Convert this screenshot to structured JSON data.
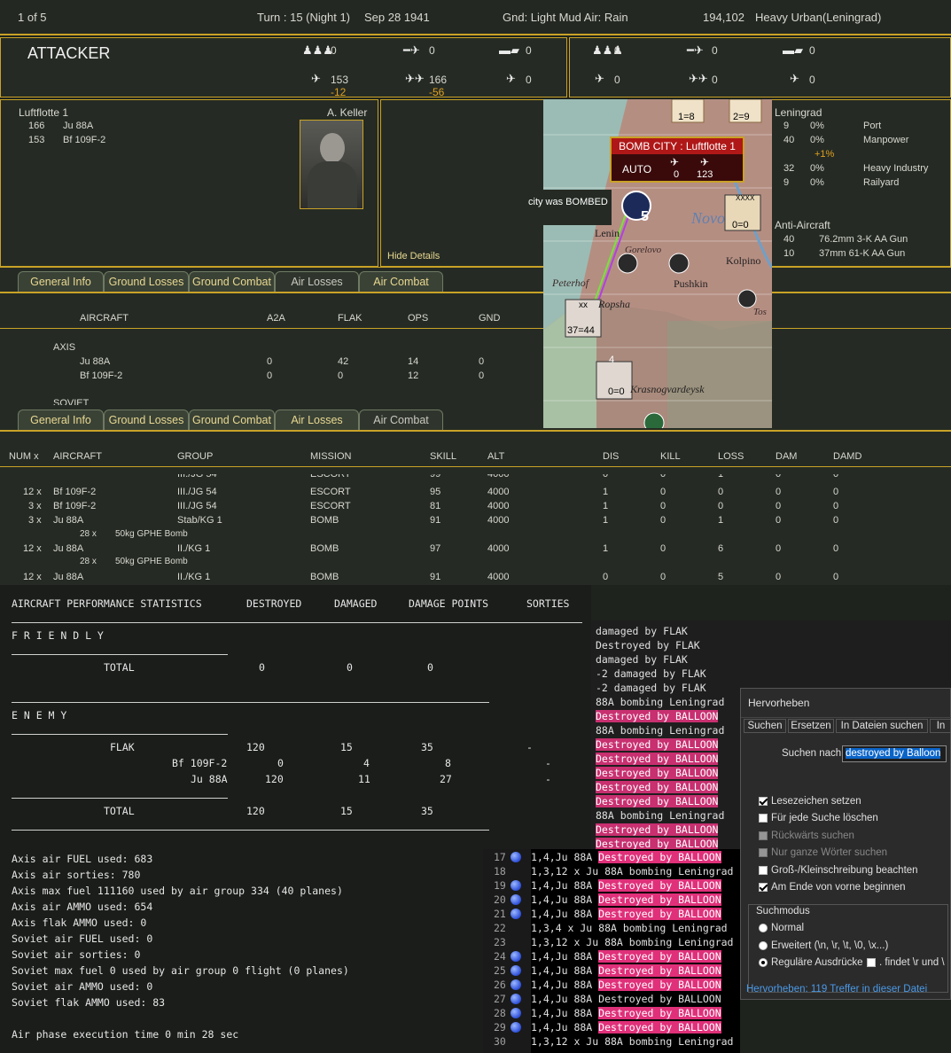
{
  "header": {
    "page_of": "1 of 5",
    "turn": "Turn : 15 (Night 1)",
    "date": "Sep 28 1941",
    "weather": "Gnd: Light Mud  Air: Rain",
    "population": "194,102",
    "terrain": "Heavy Urban(Leningrad)"
  },
  "attacker": {
    "title": "ATTACKER",
    "inf": "0",
    "art": "0",
    "tank": "0",
    "fighter": "153",
    "fighter_loss": "-12",
    "bomber": "166",
    "bomber_loss": "-56",
    "other": "0"
  },
  "defender": {
    "inf": "0",
    "art": "0",
    "tank": "0",
    "fighter": "0",
    "bomber": "0",
    "other": "0"
  },
  "unit": {
    "name": "Luftflotte 1",
    "commander": "A. Keller",
    "rows": [
      {
        "count": "166",
        "type": "Ju 88A"
      },
      {
        "count": "153",
        "type": "Bf 109F-2"
      }
    ],
    "hide_details": "Hide Details"
  },
  "map": {
    "popup_title": "BOMB CITY : Luftflotte 1",
    "popup_auto": "AUTO",
    "popup_fighters": "0",
    "popup_bombers": "123",
    "bombed_label": "city was BOMBED",
    "places": [
      "Peterhof",
      "Pushkin",
      "Kolpino",
      "Ropsha",
      "Krasnogvardeysk",
      "Lenin",
      "Novo",
      "Gorelovo",
      "Tos"
    ],
    "counter_a": "1=8",
    "counter_b": "2=9",
    "counter_c": "0=0",
    "counter_d": "37=44",
    "counter_e": "0=0",
    "counter_xx": "xx",
    "counter_xxxx": "XXXX",
    "num4": "4",
    "num5": "5"
  },
  "city": {
    "name": "Leningrad",
    "rows": [
      {
        "v": "9",
        "pct": "0%",
        "label": "Port"
      },
      {
        "v": "40",
        "pct": "0%",
        "label": "Manpower"
      },
      {
        "v": "",
        "pct": "+1%",
        "label": ""
      },
      {
        "v": "32",
        "pct": "0%",
        "label": "Heavy Industry"
      },
      {
        "v": "9",
        "pct": "0%",
        "label": "Railyard"
      }
    ],
    "aa_title": "Anti-Aircraft",
    "aa": [
      {
        "v": "40",
        "label": "76.2mm 3-K AA Gun"
      },
      {
        "v": "10",
        "label": "37mm 61-K AA Gun"
      }
    ]
  },
  "tabs": [
    "General Info",
    "Ground Losses",
    "Ground Combat",
    "Air Losses",
    "Air Combat"
  ],
  "loss_table": {
    "headers": [
      "AIRCRAFT",
      "A2A",
      "FLAK",
      "OPS",
      "GND"
    ],
    "axis_label": "AXIS",
    "rows": [
      [
        "Ju 88A",
        "0",
        "42",
        "14",
        "0"
      ],
      [
        "Bf 109F-2",
        "0",
        "0",
        "12",
        "0"
      ]
    ],
    "soviet_label": "SOVIET"
  },
  "combat_table": {
    "headers": [
      "NUM x",
      "AIRCRAFT",
      "GROUP",
      "MISSION",
      "SKILL",
      "ALT",
      "DIS",
      "KILL",
      "LOSS",
      "DAM",
      "DAMD"
    ],
    "partial_row": [
      "",
      "",
      "III./JG 54",
      "ESCORT",
      "99",
      "4000",
      "0",
      "0",
      "1",
      "0",
      "0"
    ],
    "rows": [
      [
        "12 x",
        "Bf 109F-2",
        "III./JG 54",
        "ESCORT",
        "95",
        "4000",
        "1",
        "0",
        "0",
        "0",
        "0"
      ],
      [
        "3 x",
        "Bf 109F-2",
        "III./JG 54",
        "ESCORT",
        "81",
        "4000",
        "1",
        "0",
        "0",
        "0",
        "0"
      ],
      [
        "3 x",
        "Ju 88A",
        "Stab/KG 1",
        "BOMB",
        "91",
        "4000",
        "1",
        "0",
        "1",
        "0",
        "0"
      ],
      [
        "12 x",
        "Ju 88A",
        "II./KG 1",
        "BOMB",
        "97",
        "4000",
        "1",
        "0",
        "6",
        "0",
        "0"
      ],
      [
        "12 x",
        "Ju 88A",
        "II./KG 1",
        "BOMB",
        "91",
        "4000",
        "0",
        "0",
        "5",
        "0",
        "0"
      ]
    ],
    "bomb_count": "28 x",
    "bomb_type": "50kg GPHE Bomb"
  },
  "stats": {
    "headers": [
      "AIRCRAFT PERFORMANCE STATISTICS",
      "DESTROYED",
      "DAMAGED",
      "DAMAGE POINTS",
      "SORTIES"
    ],
    "friendly": "F R I E N D L Y",
    "total": "TOTAL",
    "friendly_total": [
      "0",
      "0",
      "0"
    ],
    "enemy": "E N E M Y",
    "flak": [
      "FLAK",
      "120",
      "15",
      "35",
      "-"
    ],
    "bf": [
      "Bf 109F-2",
      "0",
      "4",
      "8",
      "-"
    ],
    "ju": [
      "Ju 88A",
      "120",
      "11",
      "27",
      "-"
    ],
    "enemy_total": [
      "120",
      "15",
      "35"
    ],
    "summary": [
      "Axis air FUEL used: 683",
      "Axis air sorties: 780",
      "Axis max fuel 111160 used by air group 334 (40 planes)",
      "Axis air AMMO used: 654",
      "Axis flak AMMO used: 0",
      "Soviet air FUEL used: 0",
      "Soviet air sorties: 0",
      "Soviet max fuel 0 used by air group 0 flight (0 planes)",
      "Soviet air AMMO used: 0",
      "Soviet flak AMMO used: 83"
    ],
    "exec": "Air phase execution time 0 min 28 sec"
  },
  "log_top": [
    "damaged by FLAK",
    "Destroyed by FLAK",
    "damaged by FLAK",
    "-2 damaged by FLAK",
    "-2 damaged by FLAK",
    "88A bombing Leningrad",
    "Destroyed by BALLOON",
    " 88A bombing Leningrad",
    "Destroyed by BALLOON",
    "Destroyed by BALLOON",
    "Destroyed by BALLOON",
    "Destroyed by BALLOON",
    "Destroyed by BALLOON",
    " 88A bombing Leningrad",
    "Destroyed by BALLOON",
    "Destroyed by BALLOON"
  ],
  "log_code": [
    {
      "n": "17",
      "pre": "1,4,Ju 88A ",
      "msg": "Destroyed by BALLOON",
      "hl": true
    },
    {
      "n": "18",
      "pre": "1,3,12 x Ju 88A bombing Leningrad",
      "msg": "",
      "hl": false
    },
    {
      "n": "19",
      "pre": "1,4,Ju 88A ",
      "msg": "Destroyed by BALLOON",
      "hl": true
    },
    {
      "n": "20",
      "pre": "1,4,Ju 88A ",
      "msg": "Destroyed by BALLOON",
      "hl": true
    },
    {
      "n": "21",
      "pre": "1,4,Ju 88A ",
      "msg": "Destroyed by BALLOON",
      "hl": true
    },
    {
      "n": "22",
      "pre": "1,3,4 x Ju 88A bombing Leningrad",
      "msg": "",
      "hl": false
    },
    {
      "n": "23",
      "pre": "1,3,12 x Ju 88A bombing Leningrad",
      "msg": "",
      "hl": false
    },
    {
      "n": "24",
      "pre": "1,4,Ju 88A ",
      "msg": "Destroyed by BALLOON",
      "hl": true
    },
    {
      "n": "25",
      "pre": "1,4,Ju 88A ",
      "msg": "Destroyed by BALLOON",
      "hl": true
    },
    {
      "n": "26",
      "pre": "1,4,Ju 88A ",
      "msg": "Destroyed by BALLOON",
      "hl": true
    },
    {
      "n": "27",
      "pre": "1,4,Ju 88A ",
      "msg": "Destroyed by BALLOON",
      "hl": false
    },
    {
      "n": "28",
      "pre": "1,4,Ju 88A ",
      "msg": "Destroyed by BALLOON",
      "hl": true
    },
    {
      "n": "29",
      "pre": "1,4,Ju 88A ",
      "msg": "Destroyed by BALLOON",
      "hl": true
    },
    {
      "n": "30",
      "pre": "1,3,12 x Ju 88A bombing Leningrad",
      "msg": "",
      "hl": false
    }
  ],
  "dialog": {
    "title": "Hervorheben",
    "tabs": [
      "Suchen",
      "Ersetzen",
      "In Dateien suchen",
      "In"
    ],
    "search_label": "Suchen nach:",
    "search_value": "destroyed by Balloon",
    "checks": [
      {
        "label": "Lesezeichen setzen",
        "on": true
      },
      {
        "label": "Für jede Suche löschen",
        "on": false
      },
      {
        "label": "Rückwärts suchen",
        "on": false
      },
      {
        "label": "Nur ganze Wörter suchen",
        "on": false
      },
      {
        "label": "Groß-/Kleinschreibung beachten",
        "on": false
      },
      {
        "label": "Am Ende von vorne beginnen",
        "on": true
      }
    ],
    "mode_title": "Suchmodus",
    "modes": [
      "Normal",
      "Erweitert (\\n, \\r, \\t, \\0, \\x...)",
      "Reguläre Ausdrücke"
    ],
    "dot_option": ". findet \\r und \\",
    "status": "Hervorheben: 119 Treffer in dieser Datei"
  }
}
